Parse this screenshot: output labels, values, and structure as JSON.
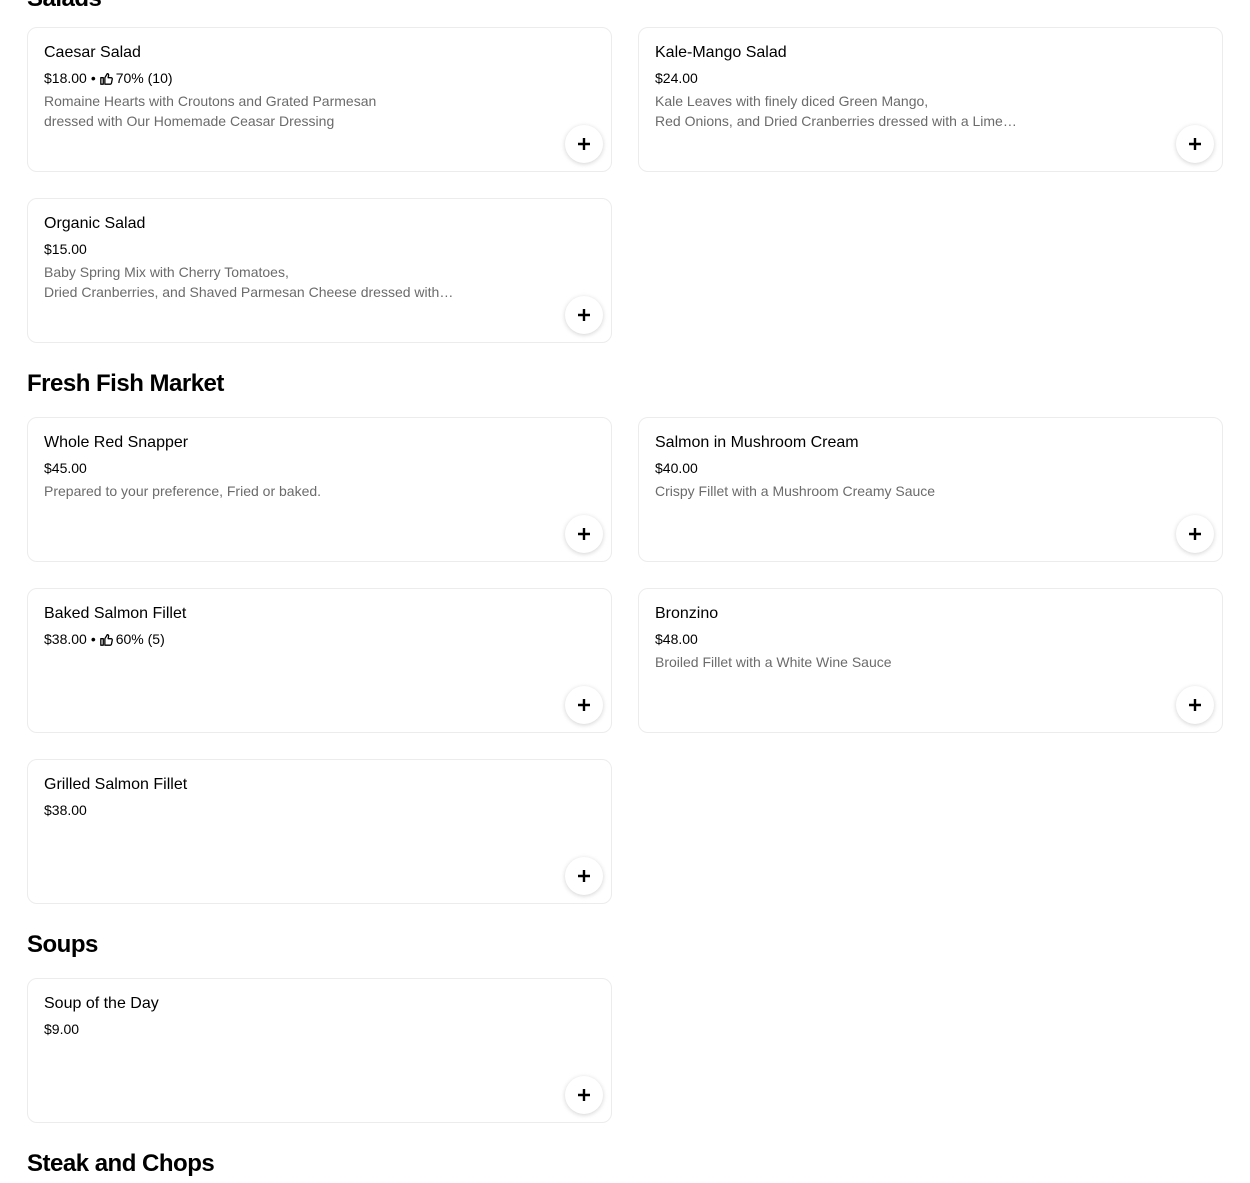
{
  "sections": {
    "salads": {
      "title": "Salads"
    },
    "fish": {
      "title": "Fresh Fish Market"
    },
    "soups": {
      "title": "Soups"
    },
    "steak": {
      "title": "Steak and Chops"
    }
  },
  "items": {
    "caesar": {
      "name": "Caesar Salad",
      "price": "$18.00",
      "rating": "70% (10)",
      "description": "Romaine Hearts with Croutons and Grated Parmesan\ndressed with Our Homemade Ceasar Dressing"
    },
    "kale": {
      "name": "Kale-Mango Salad",
      "price": "$24.00",
      "description": "Kale Leaves with finely diced Green Mango,\nRed Onions, and Dried Cranberries dressed with a Lime…"
    },
    "organic": {
      "name": "Organic Salad",
      "price": "$15.00",
      "description": "Baby Spring Mix with Cherry Tomatoes,\nDried Cranberries, and Shaved Parmesan Cheese dressed with…"
    },
    "snapper": {
      "name": "Whole Red Snapper",
      "price": "$45.00",
      "description": "Prepared to your preference, Fried or baked."
    },
    "salmon_mushroom": {
      "name": "Salmon in Mushroom Cream",
      "price": "$40.00",
      "description": "Crispy Fillet with a Mushroom Creamy Sauce"
    },
    "baked_salmon": {
      "name": "Baked Salmon Fillet",
      "price": "$38.00",
      "rating": "60% (5)"
    },
    "bronzino": {
      "name": "Bronzino",
      "price": "$48.00",
      "description": "Broiled Fillet with a White Wine Sauce"
    },
    "grilled_salmon": {
      "name": "Grilled Salmon Fillet",
      "price": "$38.00"
    },
    "soup_day": {
      "name": "Soup of the Day",
      "price": "$9.00"
    }
  },
  "separator": "•",
  "icons": {
    "rating": "thumbs-up-icon",
    "add": "plus-icon"
  }
}
